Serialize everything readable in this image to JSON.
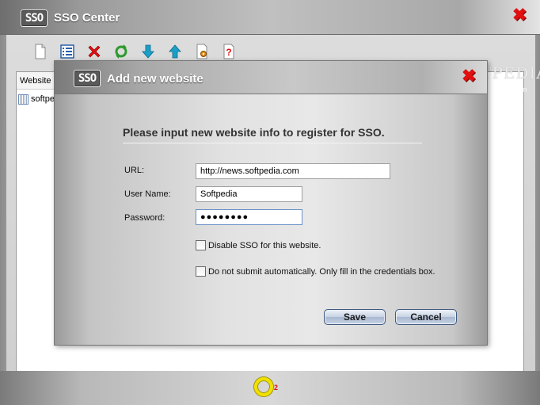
{
  "main_window": {
    "logo_text": "SSO",
    "title": "SSO Center",
    "close_glyph": "✖"
  },
  "toolbar": {
    "icons": [
      "new-document-icon",
      "list-icon",
      "delete-icon",
      "refresh-icon",
      "move-down-icon",
      "move-up-icon",
      "settings-icon",
      "help-icon"
    ],
    "help_glyph": "?"
  },
  "list": {
    "column_header": "Website",
    "rows": [
      "softpe"
    ]
  },
  "watermark": {
    "text": "SOFTPEDIA",
    "url": "www.softpedia.com"
  },
  "status": {
    "count": "2"
  },
  "dialog": {
    "logo_text": "SSO",
    "title": "Add new website",
    "close_glyph": "✖",
    "heading": "Please input new website info to register for SSO.",
    "url_label": "URL:",
    "url_value": "http://news.softpedia.com",
    "user_label": "User Name:",
    "user_value": "Softpedia",
    "password_label": "Password:",
    "password_value": "●●●●●●●●",
    "disable_sso_label": "Disable SSO for this website.",
    "no_submit_label": "Do not submit automatically. Only fill in the credentials box.",
    "save_label": "Save",
    "cancel_label": "Cancel"
  },
  "colors": {
    "close_red": "#e01010",
    "button_border": "#405a80",
    "status_ring": "#f0e000"
  }
}
